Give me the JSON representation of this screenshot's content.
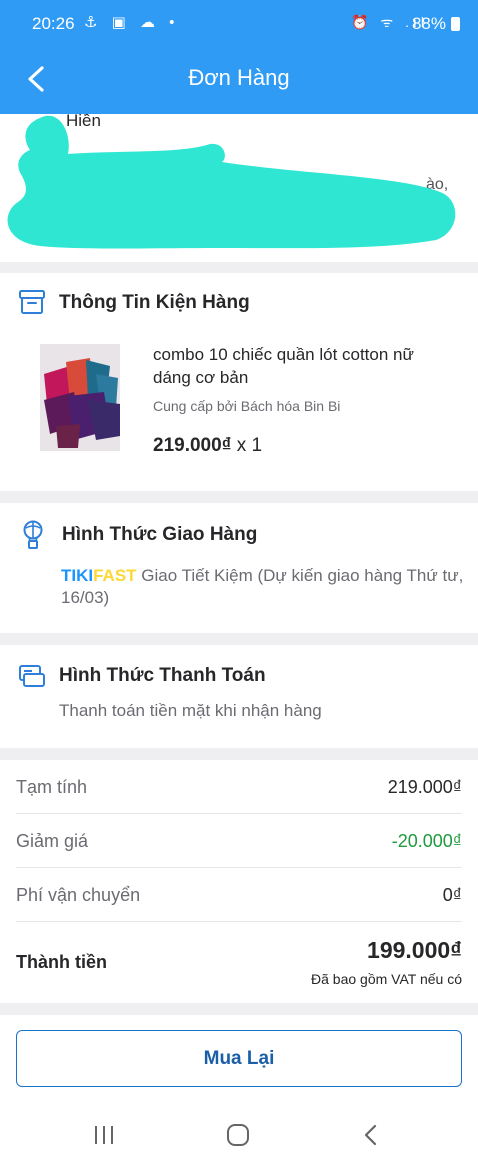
{
  "status_bar": {
    "time": "20:26",
    "left_icons": "⚓ ▣ ☁ •",
    "right_icons": "⏰ ᯤ .ıl",
    "battery": "88%"
  },
  "header": {
    "title": "Đơn Hàng"
  },
  "address": {
    "name": "Hiền",
    "trailing_text": "ào,"
  },
  "package": {
    "title": "Thông Tin Kiện Hàng",
    "product_name": "combo 10 chiếc quần lót cotton nữ dáng cơ bản",
    "seller": "Cung cấp bởi Bách hóa Bin Bi",
    "price": "219.000₫",
    "quantity": "x 1"
  },
  "shipping": {
    "title": "Hình Thức Giao Hàng",
    "brand_part1": "TIKI",
    "brand_part2": "FAST",
    "description": " Giao Tiết Kiệm (Dự kiến giao hàng Thứ tư, 16/03)"
  },
  "payment": {
    "title": "Hình Thức Thanh Toán",
    "method": "Thanh toán tiền mặt khi nhận hàng"
  },
  "summary": {
    "subtotal_label": "Tạm tính",
    "subtotal_value": "219.000₫",
    "discount_label": "Giảm giá",
    "discount_value": "-20.000₫",
    "shipping_label": "Phí vận chuyển",
    "shipping_value": "0₫",
    "total_label": "Thành tiền",
    "total_value": "199.000₫",
    "vat_note": "Đã bao gồm VAT nếu có"
  },
  "actions": {
    "rebuy_label": "Mua Lại"
  },
  "colors": {
    "brand_blue": "#2f9bf5",
    "discount_green": "#1f9a3c",
    "highlight_scribble": "#2ee6d1"
  }
}
